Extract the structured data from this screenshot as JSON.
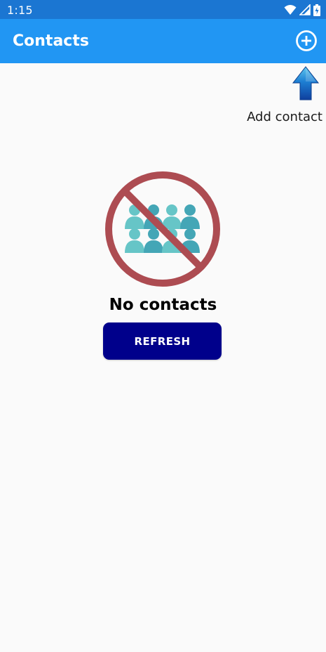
{
  "status_bar": {
    "time": "1:15",
    "icons": [
      "wifi-icon",
      "signal-icon",
      "battery-icon"
    ],
    "background": "#1b76d2"
  },
  "app_bar": {
    "title": "Contacts",
    "action_icon": "add-circle-icon",
    "background": "#2196f3"
  },
  "hint": {
    "icon": "arrow-up-icon",
    "label": "Add contact"
  },
  "empty_state": {
    "illustration": "no-contacts-icon",
    "title": "No contacts",
    "button_label": "REFRESH",
    "button_color": "#00008b",
    "prohibition_color": "#ad4c52",
    "people_colors": [
      "#66c5c7",
      "#44a6b6"
    ]
  }
}
